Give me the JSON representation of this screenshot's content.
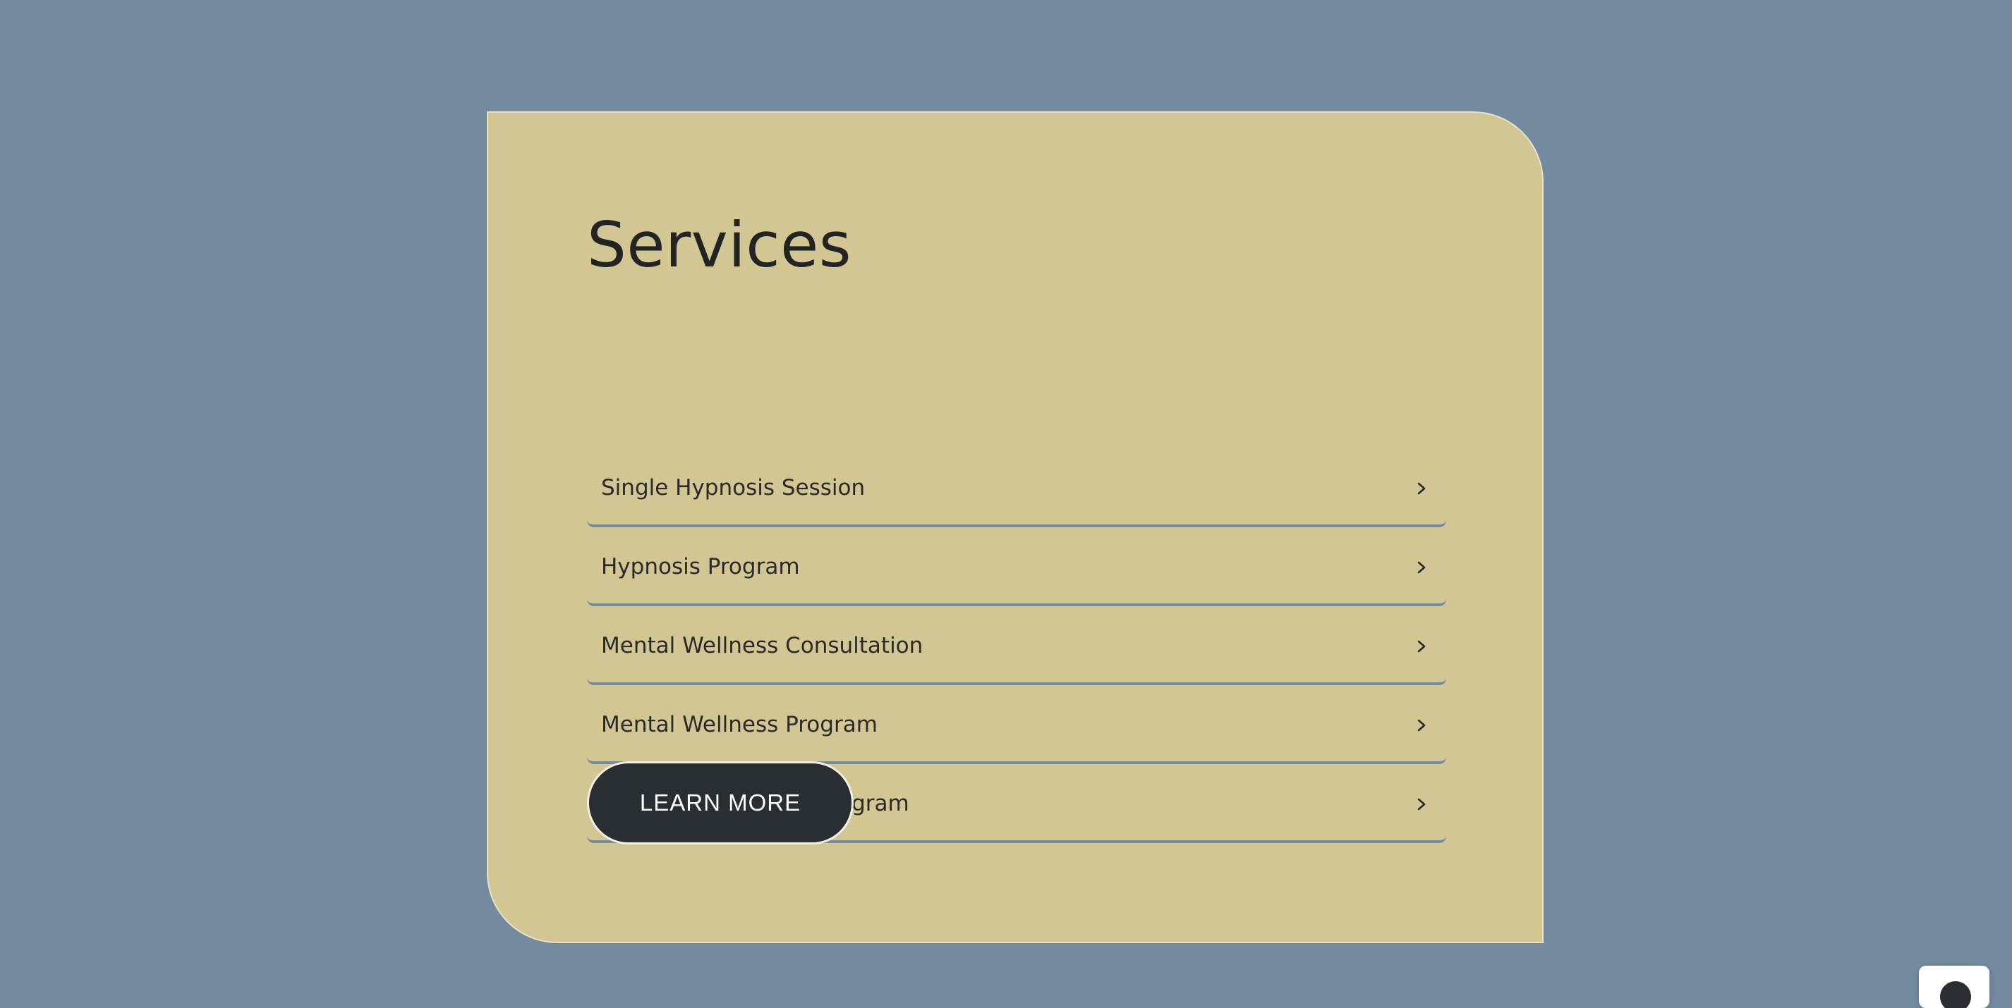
{
  "services": {
    "title": "Services",
    "items": [
      {
        "label": "Single Hypnosis Session"
      },
      {
        "label": "Hypnosis Program"
      },
      {
        "label": "Mental Wellness Consultation"
      },
      {
        "label": "Mental Wellness Program"
      },
      {
        "label": "Inner Child Healing Program"
      }
    ],
    "cta_label": "LEARN MORE"
  },
  "icons": {
    "item_chevron": "chevron-right-icon",
    "chat": "chat-icon"
  },
  "colors": {
    "page_background": "#738a9f",
    "card_background": "#d2c692",
    "card_border": "#e9e2c6",
    "text": "#222323",
    "divider": "#738a9f",
    "button_background": "#292e32",
    "button_text": "#ffffff",
    "button_border": "#f2eee0"
  }
}
